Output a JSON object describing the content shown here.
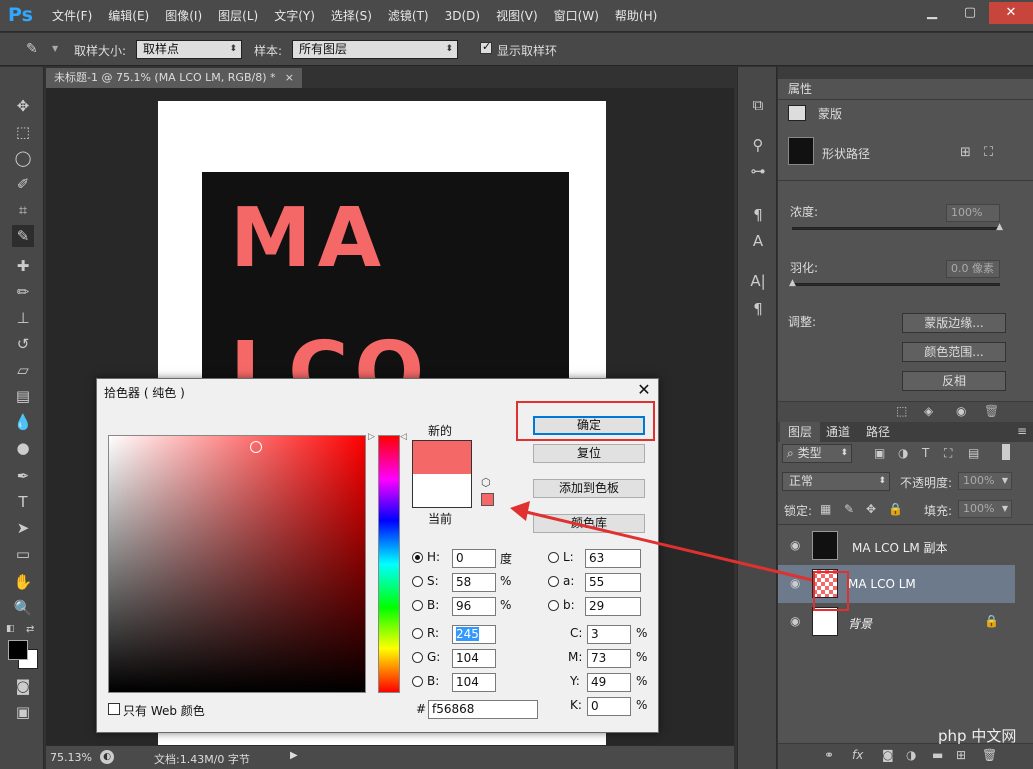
{
  "app": {
    "logo": "Ps"
  },
  "menu": [
    "文件(F)",
    "编辑(E)",
    "图像(I)",
    "图层(L)",
    "文字(Y)",
    "选择(S)",
    "滤镜(T)",
    "3D(D)",
    "视图(V)",
    "窗口(W)",
    "帮助(H)"
  ],
  "options": {
    "sample_size_label": "取样大小:",
    "sample_size_value": "取样点",
    "sample_label": "样本:",
    "sample_value": "所有图层",
    "show_ring_label": "显示取样环"
  },
  "document": {
    "tab_title": "未标题-1 @ 75.1% (MA LCO LM, RGB/8) *",
    "canvas_text_line1": "MA",
    "canvas_text_line2": "LCO",
    "zoom": "75.13%",
    "doc_info": "文档:1.43M/0 字节"
  },
  "properties": {
    "tab": "属性",
    "mask_label": "蒙版",
    "shape_path_label": "形状路径",
    "density_label": "浓度:",
    "density_value": "100%",
    "feather_label": "羽化:",
    "feather_value": "0.0 像素",
    "adjust_label": "调整:",
    "btn_mask_edge": "蒙版边缘...",
    "btn_color_range": "颜色范围...",
    "btn_invert": "反相"
  },
  "layers_panel": {
    "tabs": [
      "图层",
      "通道",
      "路径"
    ],
    "filter_label": "类型",
    "blend_mode": "正常",
    "opacity_label": "不透明度:",
    "opacity_value": "100%",
    "lock_label": "锁定:",
    "fill_label": "填充:",
    "fill_value": "100%",
    "layers": [
      {
        "name": "MA LCO LM 副本"
      },
      {
        "name": "MA LCO LM"
      },
      {
        "name": "背景"
      }
    ]
  },
  "color_picker": {
    "title": "拾色器 ( 纯色 )",
    "new_label": "新的",
    "current_label": "当前",
    "ok_label": "确定",
    "reset_label": "复位",
    "add_swatch_label": "添加到色板",
    "color_lib_label": "颜色库",
    "web_only_label": "只有 Web 颜色",
    "H_label": "H:",
    "H": "0",
    "H_unit": "度",
    "S_label": "S:",
    "S": "58",
    "S_unit": "%",
    "Bv_label": "B:",
    "Bv": "96",
    "Bv_unit": "%",
    "R_label": "R:",
    "R": "245",
    "G_label": "G:",
    "G": "104",
    "Bc_label": "B:",
    "Bc": "104",
    "L_label": "L:",
    "L": "63",
    "a_label": "a:",
    "a": "55",
    "b_label": "b:",
    "b": "29",
    "C_label": "C:",
    "C": "3",
    "C_unit": "%",
    "M_label": "M:",
    "M": "73",
    "M_unit": "%",
    "Y_label": "Y:",
    "Y": "49",
    "Y_unit": "%",
    "K_label": "K:",
    "K": "0",
    "K_unit": "%",
    "hex_label": "#",
    "hex": "f56868"
  },
  "colors": {
    "accent_pink": "#f56868",
    "highlight_red": "#e03131",
    "ps_blue": "#31a8ff"
  },
  "watermark": "php 中文网"
}
